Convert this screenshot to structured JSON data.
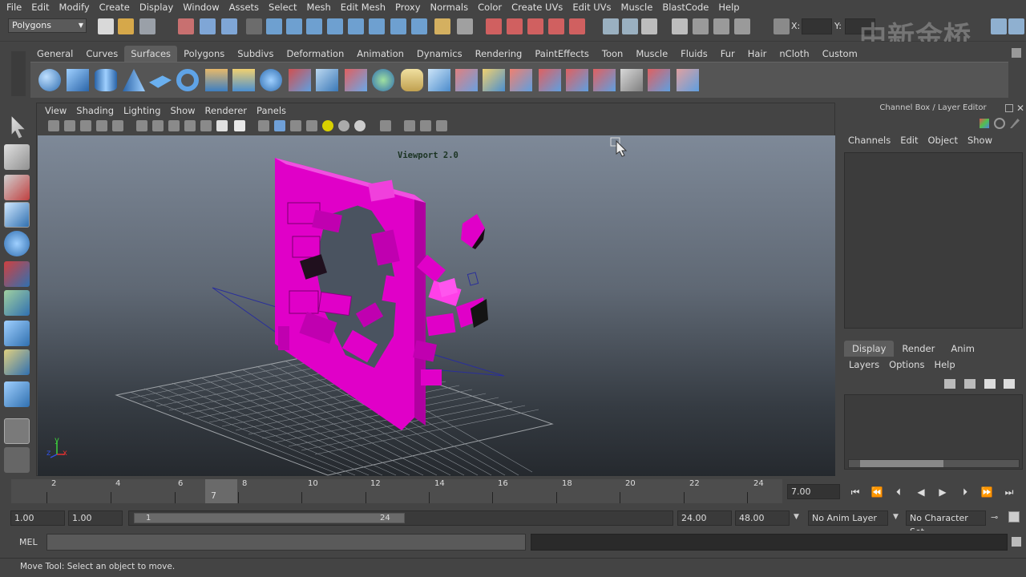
{
  "menubar": {
    "items": [
      "File",
      "Edit",
      "Modify",
      "Create",
      "Display",
      "Window",
      "Assets",
      "Select",
      "Mesh",
      "Edit Mesh",
      "Proxy",
      "Normals",
      "Color",
      "Create UVs",
      "Edit UVs",
      "Muscle",
      "BlastCode",
      "Help"
    ]
  },
  "statusline": {
    "mode": "Polygons",
    "x_label": "X:",
    "y_label": "Y:",
    "watermark": "中新金桥"
  },
  "shelf": {
    "tabs": [
      "General",
      "Curves",
      "Surfaces",
      "Polygons",
      "Subdivs",
      "Deformation",
      "Animation",
      "Dynamics",
      "Rendering",
      "PaintEffects",
      "Toon",
      "Muscle",
      "Fluids",
      "Fur",
      "Hair",
      "nCloth",
      "Custom"
    ],
    "active_tab": "Surfaces"
  },
  "viewport": {
    "menu": [
      "View",
      "Shading",
      "Lighting",
      "Show",
      "Renderer",
      "Panels"
    ],
    "overlay_label": "Viewport 2.0",
    "axis_labels": {
      "y": "y",
      "x": "x",
      "z": "z"
    },
    "object_color": "#e000c8"
  },
  "channelbox": {
    "title": "Channel Box / Layer Editor",
    "menu": [
      "Channels",
      "Edit",
      "Object",
      "Show"
    ],
    "layer_tabs": [
      "Display",
      "Render",
      "Anim"
    ],
    "active_layer_tab": "Display",
    "layer_menu": [
      "Layers",
      "Options",
      "Help"
    ]
  },
  "timeslider": {
    "tick_labels": [
      "2",
      "4",
      "6",
      "8",
      "10",
      "12",
      "14",
      "16",
      "18",
      "20",
      "22",
      "24"
    ],
    "current_frame": "7",
    "current_time": "7.00"
  },
  "range": {
    "start": "1.00",
    "start2": "1.00",
    "range_start": "1",
    "range_end": "24",
    "end": "24.00",
    "end2": "48.00",
    "anim_layer": "No Anim Layer",
    "character_set": "No Character Set"
  },
  "mel": {
    "label": "MEL"
  },
  "helpline": {
    "text": "Move Tool: Select an object to move."
  }
}
